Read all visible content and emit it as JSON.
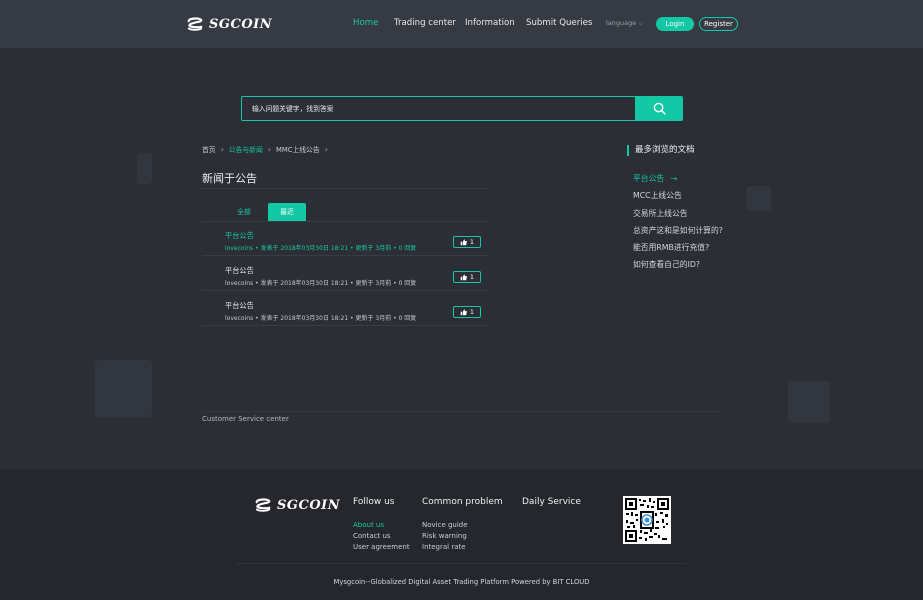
{
  "brand": {
    "name": "SGCOIN",
    "accent": "#13c8a4"
  },
  "nav": {
    "items": [
      {
        "label": "Home",
        "active": true
      },
      {
        "label": "Trading center",
        "active": false
      },
      {
        "label": "Information",
        "active": false
      },
      {
        "label": "Submit Queries",
        "active": false
      }
    ],
    "language_label": "language",
    "login_label": "Login",
    "register_label": "Register"
  },
  "search": {
    "placeholder": "输入问题关键字，找到答案",
    "icon": "search-icon"
  },
  "breadcrumb": {
    "items": [
      "首页",
      "公告与新闻",
      "MMC上线公告"
    ]
  },
  "page_title": "新闻于公告",
  "tabs": [
    {
      "label": "全部",
      "active": false
    },
    {
      "label": "最近",
      "active": true
    }
  ],
  "news": [
    {
      "title": "平台公告",
      "meta": "lovecoins • 发表于 2018年03月30日 18:21 • 更新于 3月前 • 0 回复",
      "likes": "1",
      "highlight": true
    },
    {
      "title": "平台公告",
      "meta": "lovecoins • 发表于 2018年03月30日 18:21 • 更新于 3月前 • 0 回复",
      "likes": "1",
      "highlight": false
    },
    {
      "title": "平台公告",
      "meta": "lovecoins • 发表于 2018年03月30日 18:21 • 更新于 3月前 • 0 回复",
      "likes": "1",
      "highlight": false
    }
  ],
  "sidebar": {
    "title": "最多浏览的文档",
    "items": [
      {
        "label": "平台公告",
        "highlight": true
      },
      {
        "label": "MCC上线公告",
        "highlight": false
      },
      {
        "label": "交易所上线公告",
        "highlight": false
      },
      {
        "label": "总资产这和是如何计算的?",
        "highlight": false
      },
      {
        "label": "能否用RMB进行充值?",
        "highlight": false
      },
      {
        "label": "如何查看自己的ID?",
        "highlight": false
      }
    ]
  },
  "customer_service": "Customer Service center",
  "footer": {
    "columns": [
      {
        "title": "Follow us",
        "links": [
          "About us",
          "Contact us",
          "User agreement"
        ]
      },
      {
        "title": "Common problem",
        "links": [
          "Novice guide",
          "Risk warning",
          "Integral rate"
        ]
      },
      {
        "title": "Daily Service",
        "links": []
      }
    ],
    "copyright": "Mysgcoin--Globalized Digital Asset Trading Platform Powered by BIT CLOUD"
  }
}
